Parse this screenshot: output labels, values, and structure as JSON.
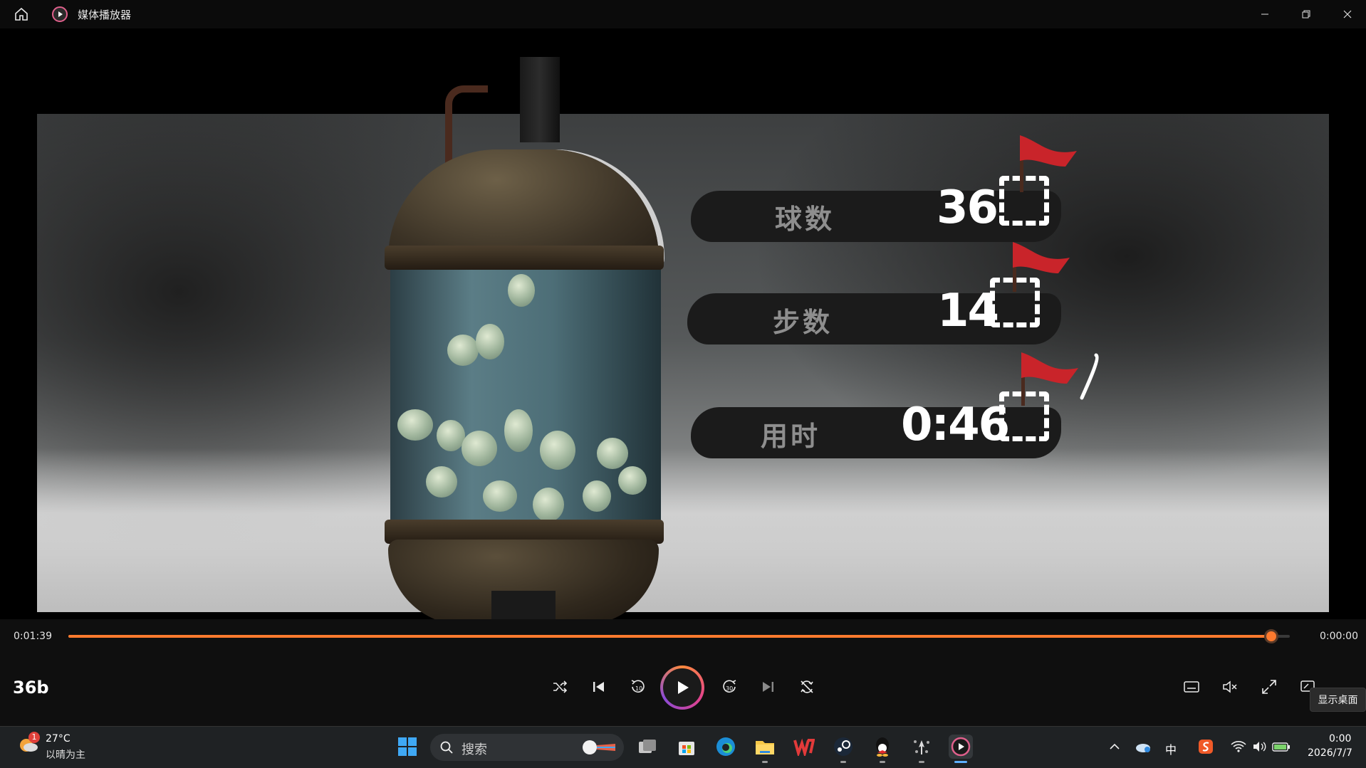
{
  "window": {
    "title": "媒体播放器",
    "icons": [
      "home-icon",
      "media-player-icon",
      "minimize-icon",
      "restore-icon",
      "close-icon"
    ]
  },
  "video": {
    "scoreboard": [
      {
        "label": "球数",
        "value": "36"
      },
      {
        "label": "步数",
        "value": "14"
      },
      {
        "label": "用时",
        "value": "0:46"
      }
    ]
  },
  "player": {
    "elapsed": "0:01:39",
    "remaining": "0:00:00",
    "progress_fraction": 0.985,
    "media_title": "36b",
    "accent_color": "#ff7a2e",
    "controls": [
      "shuffle-icon",
      "previous-icon",
      "rewind-10-icon",
      "play-icon",
      "forward-30-icon",
      "next-icon",
      "repeat-off-icon"
    ],
    "right_controls": [
      "subtitles-icon",
      "mute-icon",
      "fullscreen-icon",
      "miniplayer-icon"
    ],
    "tooltip": "显示桌面"
  },
  "taskbar": {
    "weather": {
      "badge": "1",
      "temp": "27°C",
      "desc": "以晴为主"
    },
    "search_placeholder": "搜索",
    "apps": [
      "windows-start-icon",
      "task-view-icon",
      "store-icon",
      "edge-icon",
      "file-explorer-icon",
      "wps-icon",
      "steam-icon",
      "qq-icon",
      "game-icon",
      "media-player-icon"
    ],
    "tray": {
      "ime": "中",
      "time": "0:00",
      "date": "2026/7/7"
    }
  }
}
